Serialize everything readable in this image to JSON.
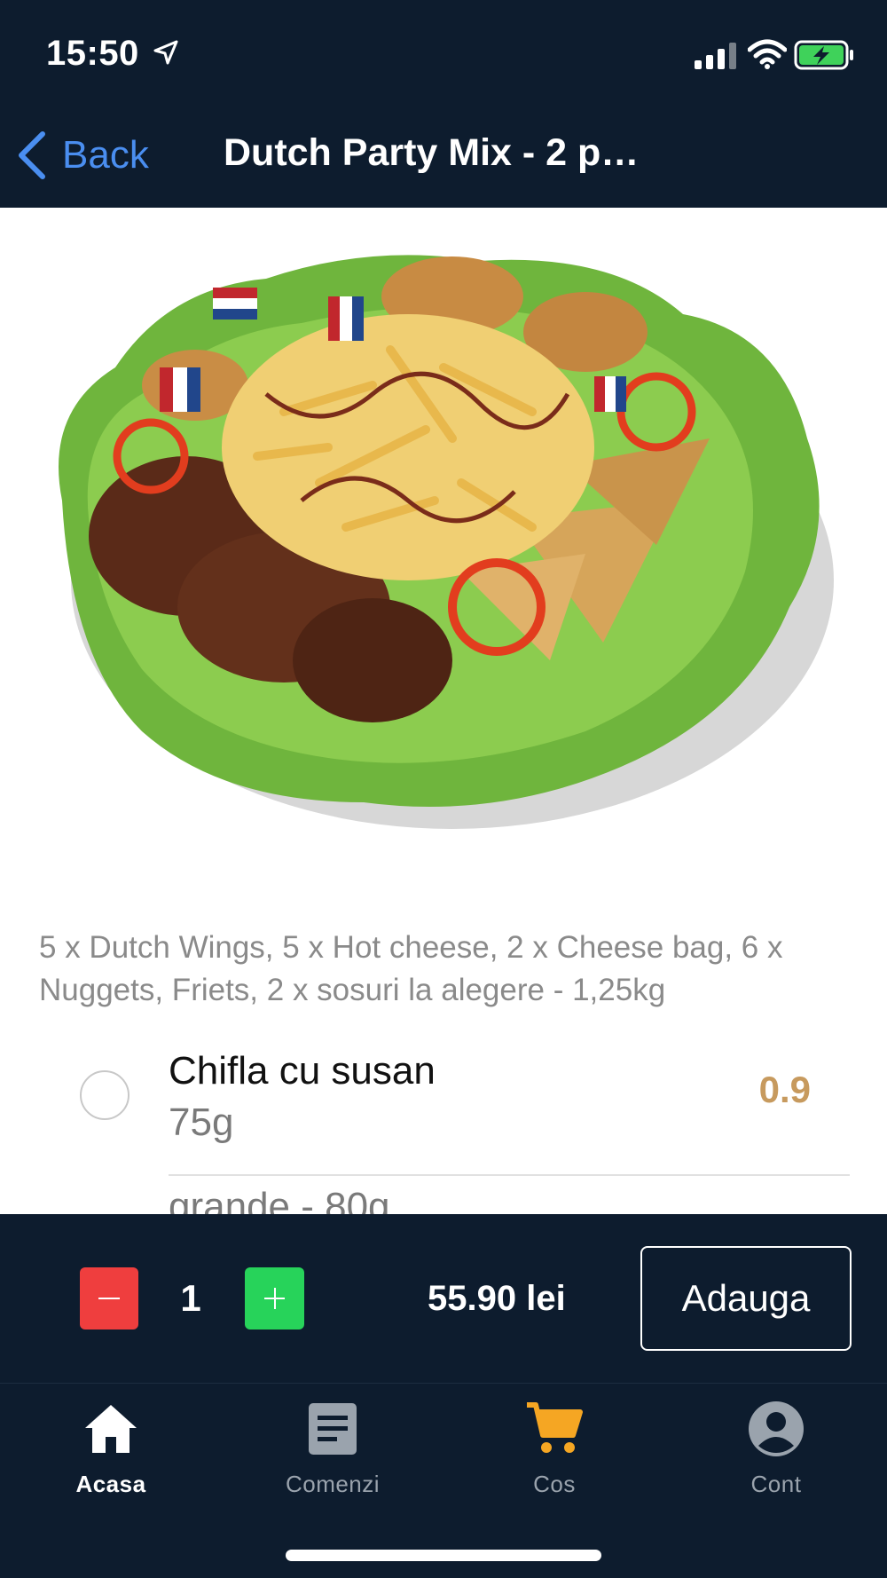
{
  "status_bar": {
    "time": "15:50",
    "icons": [
      "location-arrow-icon",
      "cellular-signal-icon",
      "wifi-icon",
      "battery-charging-icon"
    ]
  },
  "nav": {
    "back_label": "Back",
    "title": "Dutch Party Mix - 2 p…"
  },
  "product": {
    "description": "5 x Dutch Wings, 5 x Hot cheese, 2 x Cheese bag, 6 x Nuggets, Friets, 2 x sosuri la alegere - 1,25kg",
    "options": [
      {
        "name": "Chifla cu susan",
        "weight": "75g",
        "price": "0.9",
        "selected": false
      },
      {
        "name": "",
        "weight": "grande - 80g",
        "price": ""
      }
    ]
  },
  "cart_bar": {
    "quantity": "1",
    "total": "55.90 lei",
    "add_label": "Adauga",
    "minus_color": "#ef3e3e",
    "plus_color": "#27d35a"
  },
  "tabs": [
    {
      "label": "Acasa",
      "icon": "home-icon",
      "active": true
    },
    {
      "label": "Comenzi",
      "icon": "orders-document-icon",
      "active": false
    },
    {
      "label": "Cos",
      "icon": "cart-icon",
      "active": false
    },
    {
      "label": "Cont",
      "icon": "account-icon",
      "active": false
    }
  ],
  "colors": {
    "header_bg": "#0d1c2e",
    "back_link": "#4a8ef0",
    "price_accent": "#c79a5e",
    "cart_tab": "#f5a623"
  }
}
